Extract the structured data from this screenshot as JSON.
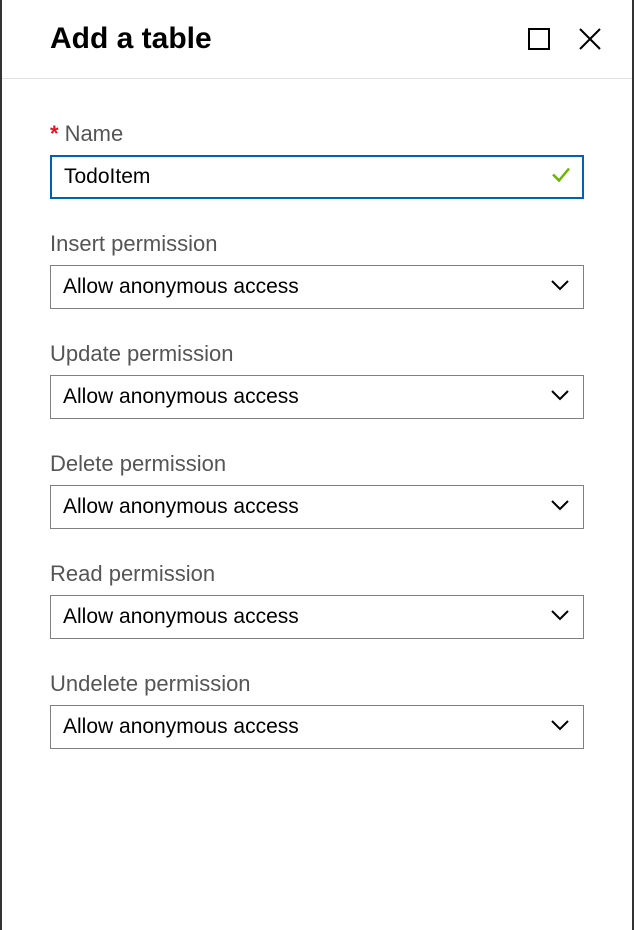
{
  "header": {
    "title": "Add a table"
  },
  "form": {
    "name": {
      "label": "Name",
      "required_mark": "*",
      "value": "TodoItem"
    },
    "permissions": [
      {
        "label": "Insert permission",
        "value": "Allow anonymous access"
      },
      {
        "label": "Update permission",
        "value": "Allow anonymous access"
      },
      {
        "label": "Delete permission",
        "value": "Allow anonymous access"
      },
      {
        "label": "Read permission",
        "value": "Allow anonymous access"
      },
      {
        "label": "Undelete permission",
        "value": "Allow anonymous access"
      }
    ]
  }
}
